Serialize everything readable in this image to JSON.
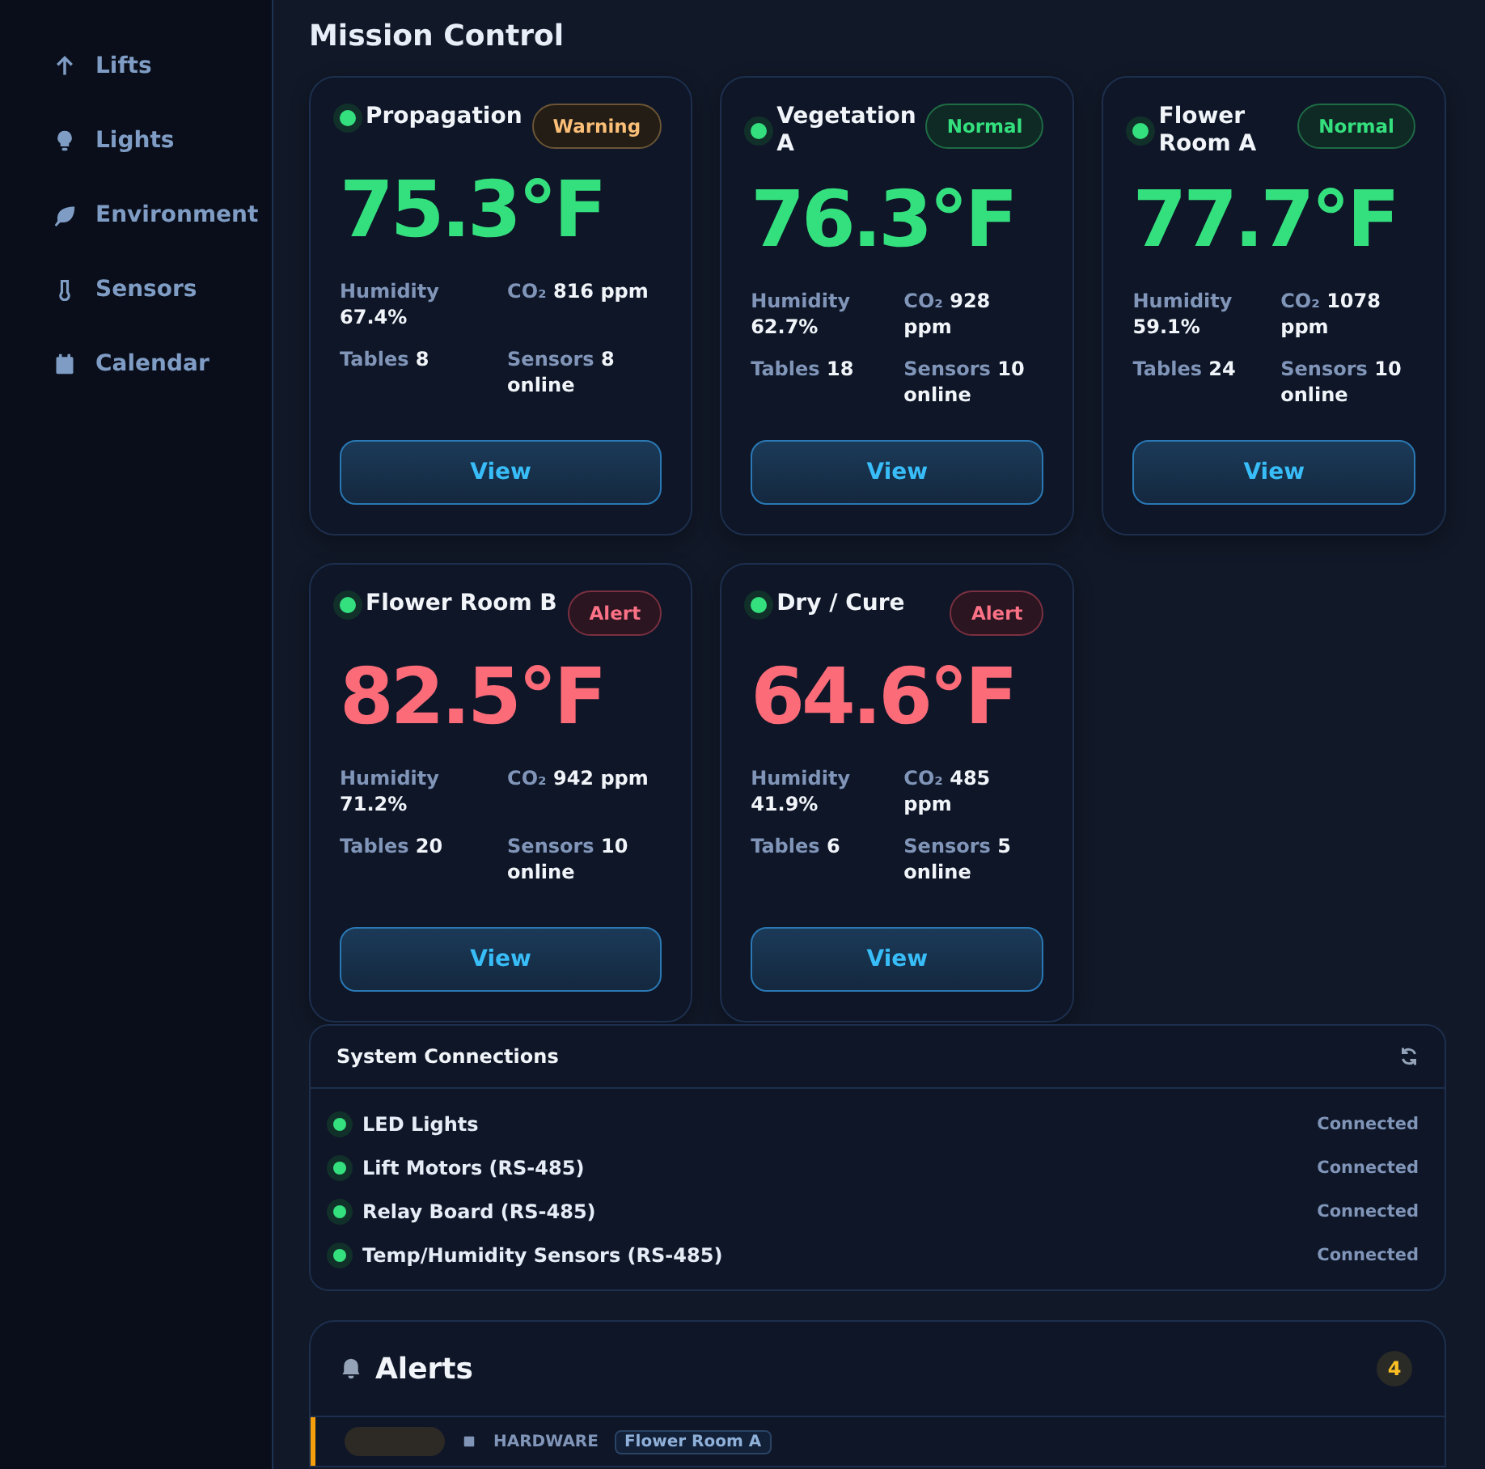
{
  "sidebar": {
    "items": [
      {
        "label": "Lifts"
      },
      {
        "label": "Lights"
      },
      {
        "label": "Environment"
      },
      {
        "label": "Sensors"
      },
      {
        "label": "Calendar"
      }
    ]
  },
  "title": "Mission Control",
  "rooms": [
    {
      "name": "Propagation",
      "status": {
        "kind": "warning",
        "label": "Warning"
      },
      "temperature": "75.3°F",
      "temp_alert": false,
      "stats": [
        {
          "label": "Humidity",
          "value": "67.4%"
        },
        {
          "label": "CO₂",
          "value": "816 ppm"
        },
        {
          "label": "Tables",
          "value": "8"
        },
        {
          "label": "Sensors",
          "value": "8 online"
        }
      ],
      "button": "View"
    },
    {
      "name": "Vegetation A",
      "status": {
        "kind": "normal",
        "label": "Normal"
      },
      "temperature": "76.3°F",
      "temp_alert": false,
      "stats": [
        {
          "label": "Humidity",
          "value": "62.7%"
        },
        {
          "label": "CO₂",
          "value": "928 ppm"
        },
        {
          "label": "Tables",
          "value": "18"
        },
        {
          "label": "Sensors",
          "value": "10 online"
        }
      ],
      "button": "View"
    },
    {
      "name": "Flower Room A",
      "status": {
        "kind": "normal",
        "label": "Normal"
      },
      "temperature": "77.7°F",
      "temp_alert": false,
      "stats": [
        {
          "label": "Humidity",
          "value": "59.1%"
        },
        {
          "label": "CO₂",
          "value": "1078 ppm"
        },
        {
          "label": "Tables",
          "value": "24"
        },
        {
          "label": "Sensors",
          "value": "10 online"
        }
      ],
      "button": "View"
    },
    {
      "name": "Flower Room B",
      "status": {
        "kind": "alert",
        "label": "Alert"
      },
      "temperature": "82.5°F",
      "temp_alert": true,
      "stats": [
        {
          "label": "Humidity",
          "value": "71.2%"
        },
        {
          "label": "CO₂",
          "value": "942 ppm"
        },
        {
          "label": "Tables",
          "value": "20"
        },
        {
          "label": "Sensors",
          "value": "10 online"
        }
      ],
      "button": "View"
    },
    {
      "name": "Dry / Cure",
      "status": {
        "kind": "alert",
        "label": "Alert"
      },
      "temperature": "64.6°F",
      "temp_alert": true,
      "stats": [
        {
          "label": "Humidity",
          "value": "41.9%"
        },
        {
          "label": "CO₂",
          "value": "485 ppm"
        },
        {
          "label": "Tables",
          "value": "6"
        },
        {
          "label": "Sensors",
          "value": "5 online"
        }
      ],
      "button": "View"
    }
  ],
  "connections": {
    "title": "System Connections",
    "items": [
      {
        "name": "LED Lights",
        "status": "Connected",
        "connected": true
      },
      {
        "name": "Lift Motors (RS-485)",
        "status": "Connected",
        "connected": true
      },
      {
        "name": "Relay Board (RS-485)",
        "status": "Connected",
        "connected": true
      },
      {
        "name": "Temp/Humidity Sensors (RS-485)",
        "status": "Connected",
        "connected": true
      }
    ]
  },
  "alerts": {
    "title": "Alerts",
    "count": "4",
    "items": [
      {
        "category": "HARDWARE",
        "room": "Flower Room A"
      }
    ]
  }
}
